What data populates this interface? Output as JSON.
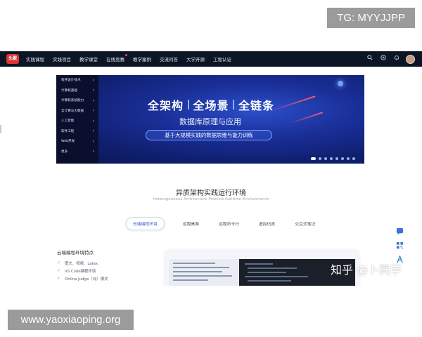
{
  "watermarks": {
    "top": "TG: MYYJJPP",
    "bottom": "www.yaoxiaoping.org",
    "zhihu": "知乎 @卜同学"
  },
  "nav": {
    "logo_text": "头歌",
    "items": [
      {
        "label": "实践课程",
        "badge": false
      },
      {
        "label": "实践项目",
        "badge": false
      },
      {
        "label": "教学课堂",
        "badge": false
      },
      {
        "label": "在线竞赛",
        "badge": true
      },
      {
        "label": "教学案例",
        "badge": false
      },
      {
        "label": "交流问答",
        "badge": false
      },
      {
        "label": "大学开源",
        "badge": false
      },
      {
        "label": "工程认证",
        "badge": false
      }
    ],
    "icons": [
      "search-icon",
      "plus-circle-icon",
      "bell-icon",
      "avatar"
    ]
  },
  "banner": {
    "side_menu": [
      "程序设计技术",
      "计算机基础",
      "计算机系统能力",
      "云计算与大数据",
      "人工智能",
      "软件工程",
      "Web开发",
      "更多"
    ],
    "headline_parts": [
      "全架构",
      "全场景",
      "全链条"
    ],
    "subtitle": "数据库原理与应用",
    "tagline": "基于大规模实践的数据思维与能力训练",
    "slides": 8,
    "active_slide": 0
  },
  "section": {
    "title": "异质架构实践运行环境",
    "subtitle": "Heterogeneous Architecture Practice Runtime Environments",
    "tabs": [
      {
        "label": "云端编程环境",
        "active": true
      },
      {
        "label": "远程桌面",
        "active": false
      },
      {
        "label": "远程命令行",
        "active": false
      },
      {
        "label": "虚拟仿真",
        "active": false
      },
      {
        "label": "交互式笔记",
        "active": false
      }
    ]
  },
  "features": {
    "title": "云端编程环境特点",
    "items": [
      "图文、视频、Latex",
      "VS Code编程环境",
      "Online Judge（OJ）模式"
    ]
  },
  "float_bar": [
    "chat-icon",
    "qrcode-icon",
    "font-icon"
  ]
}
